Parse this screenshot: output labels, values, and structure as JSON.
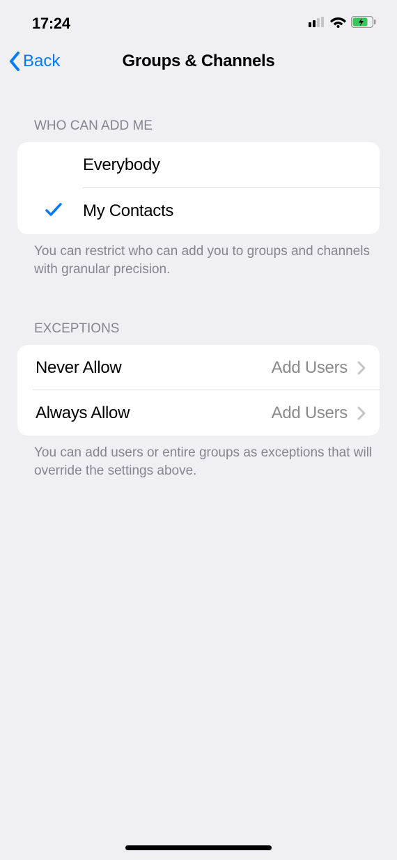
{
  "statusBar": {
    "time": "17:24"
  },
  "nav": {
    "back": "Back",
    "title": "Groups & Channels"
  },
  "whoCanAddMe": {
    "header": "WHO CAN ADD ME",
    "options": [
      {
        "label": "Everybody",
        "selected": false
      },
      {
        "label": "My Contacts",
        "selected": true
      }
    ],
    "footer": "You can restrict who can add you to groups and channels with granular precision."
  },
  "exceptions": {
    "header": "EXCEPTIONS",
    "rows": [
      {
        "label": "Never Allow",
        "value": "Add Users"
      },
      {
        "label": "Always Allow",
        "value": "Add Users"
      }
    ],
    "footer": "You can add users or entire groups as exceptions that will override the settings above."
  }
}
